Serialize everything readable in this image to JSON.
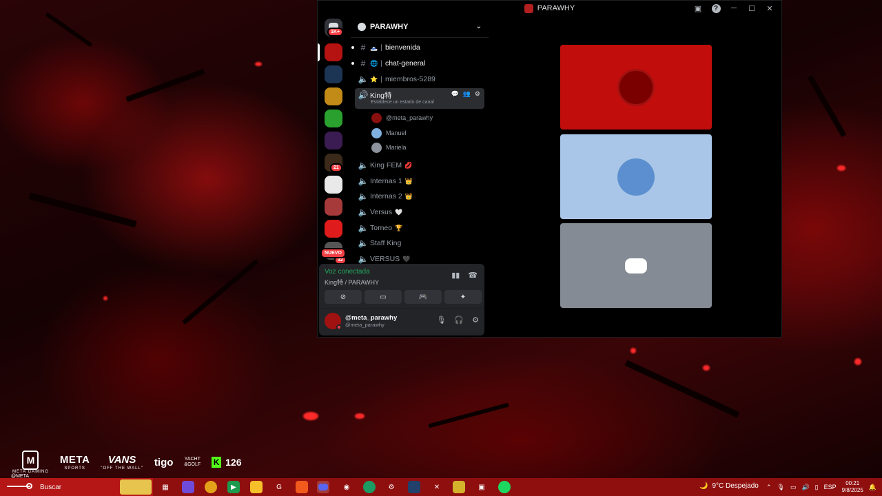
{
  "window": {
    "title": "PARAWHY"
  },
  "rail": {
    "top_badge": "1K+",
    "badge_21": "21",
    "badge_32": "32",
    "new_label": "NUEVO"
  },
  "guild": {
    "name": "PARAWHY"
  },
  "channels": [
    {
      "name": "bienvenida",
      "type": "text",
      "emoji": "🗻",
      "bright": true
    },
    {
      "name": "chat-general",
      "type": "text",
      "emoji": "🌐",
      "bright": true
    },
    {
      "name": "miembros-5289",
      "type": "voice",
      "emoji": "⭐",
      "bright": false
    }
  ],
  "active_channel": {
    "name": "King特",
    "status_prompt": "Establece un estado de canal"
  },
  "voice_users": [
    {
      "name": "@meta_parawhy",
      "color": "#8a1010"
    },
    {
      "name": "Manuel",
      "color": "#7fb0de"
    },
    {
      "name": "Mariela",
      "color": "#8d939c"
    }
  ],
  "voice_channels": [
    {
      "name": "King FEM",
      "emoji": "💋"
    },
    {
      "name": "Internas 1",
      "emoji": "👑"
    },
    {
      "name": "Internas 2",
      "emoji": "👑"
    },
    {
      "name": "Versus",
      "emoji": "🤍"
    },
    {
      "name": "Torneo",
      "emoji": "🏆"
    },
    {
      "name": "Staff King",
      "emoji": ""
    },
    {
      "name": "VERSUS",
      "emoji": "🖤"
    }
  ],
  "voice_panel": {
    "status": "Voz conectada",
    "location": "King特 / PARAWHY"
  },
  "user": {
    "name": "@meta_parawhy",
    "tag": "@meta_parawhy"
  },
  "tiles": [
    {
      "bg": "#c20d0d",
      "avatar": "#9a0000"
    },
    {
      "bg": "#a9c6e8",
      "avatar": "#5b8fcf"
    },
    {
      "bg": "#858b94",
      "avatar": "#5865f2"
    }
  ],
  "brands": {
    "meta_top": "META",
    "meta_sub": "SPORTS",
    "vans": "VANS",
    "vans_sub": "\"OFF THE WALL\"",
    "tigo": "tigo",
    "yacht_1": "YACHT",
    "yacht_2": "&GOLF",
    "kick_count": "126",
    "meta_tag": "@META",
    "meta_gaming": "META GAMING"
  },
  "taskbar": {
    "search_placeholder": "Buscar",
    "weather": "9°C  Despejado",
    "lang": "ESP",
    "time": "00:21",
    "date": "9/8/2025"
  }
}
